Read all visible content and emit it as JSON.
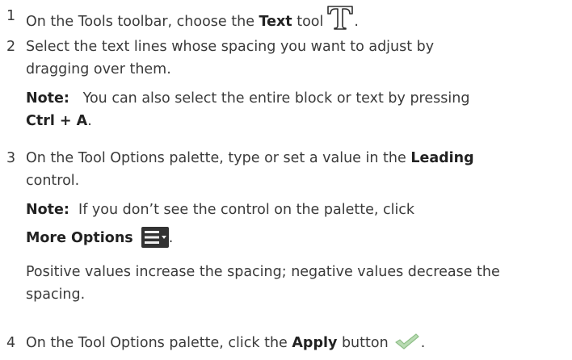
{
  "steps": [
    {
      "number": "1",
      "text_a": "On the Tools toolbar, choose the ",
      "bold": "Text",
      "text_b": " tool",
      "tail": "."
    },
    {
      "number": "2",
      "line1": "Select the text lines whose spacing you want to adjust by",
      "line2": "dragging over them.",
      "note_label": "Note:",
      "note_line1": "   You can also select the entire block or text by pressing",
      "note_shortcut": "Ctrl + A",
      "note_tail": "."
    },
    {
      "number": "3",
      "line1_a": "On the Tool Options palette, type or set a value in the ",
      "line1_bold": "Leading",
      "line2": "control.",
      "note_label": "Note:",
      "note_text": "  If you don’t see the control on the palette, click",
      "more_options": "More Options",
      "more_tail": ".",
      "para1": "Positive values increase the spacing; negative values decrease the",
      "para2": "spacing."
    },
    {
      "number": "4",
      "text_a": "On the Tool Options palette, click the ",
      "bold": "Apply",
      "text_b": " button",
      "tail": "."
    }
  ],
  "icons": {
    "text_tool": "text-tool-icon",
    "more_options": "more-options-icon",
    "apply": "apply-checkmark-icon"
  },
  "colors": {
    "text": "#3a3a3a",
    "icon_dark": "#2e2e2e",
    "checkmark": "#9fc79a"
  }
}
